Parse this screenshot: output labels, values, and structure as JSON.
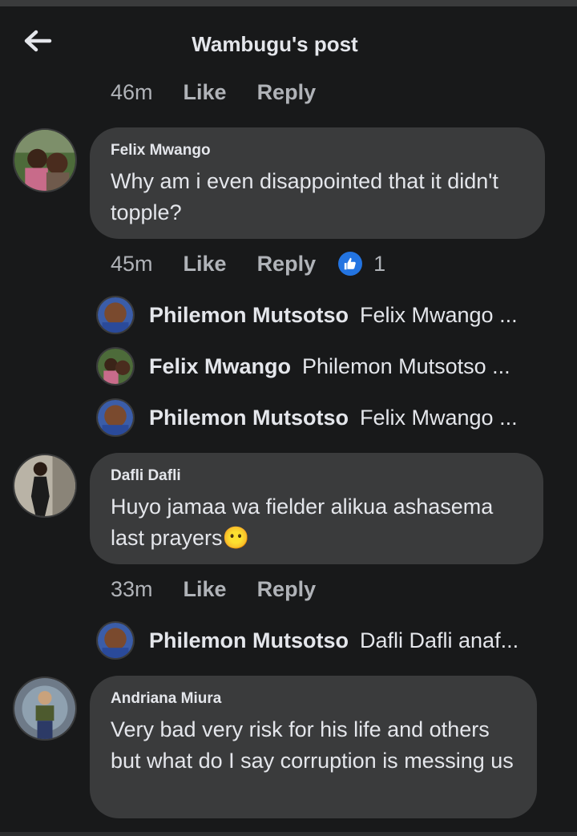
{
  "header": {
    "title": "Wambugu's post",
    "back_icon": "arrow-left-icon"
  },
  "top_meta": {
    "time": "46m",
    "like": "Like",
    "reply": "Reply"
  },
  "comments": [
    {
      "author": "Felix Mwango",
      "text": "Why am i even disappointed that it didn't topple?",
      "time": "45m",
      "like": "Like",
      "reply": "Reply",
      "reaction_icon": "thumbs-up-icon",
      "reaction_count": "1",
      "replies": [
        {
          "name": "Philemon Mutsotso",
          "preview": "Felix Mwango ..."
        },
        {
          "name": "Felix Mwango",
          "preview": "Philemon Mutsotso ..."
        },
        {
          "name": "Philemon Mutsotso",
          "preview": "Felix Mwango ..."
        }
      ]
    },
    {
      "author": "Dafli Dafli",
      "text": "Huyo jamaa wa fielder alikua ashasema last prayers",
      "emoji": "😶",
      "time": "33m",
      "like": "Like",
      "reply": "Reply",
      "replies": [
        {
          "name": "Philemon Mutsotso",
          "preview": "Dafli Dafli anaf..."
        }
      ]
    },
    {
      "author": "Andriana Miura",
      "text": "Very bad very risk for his life and others but what do I say corruption is messing us"
    }
  ],
  "colors": {
    "background": "#18191a",
    "bubble": "#3a3b3c",
    "like_blue": "#2374e1",
    "muted": "#b0b3b8"
  }
}
